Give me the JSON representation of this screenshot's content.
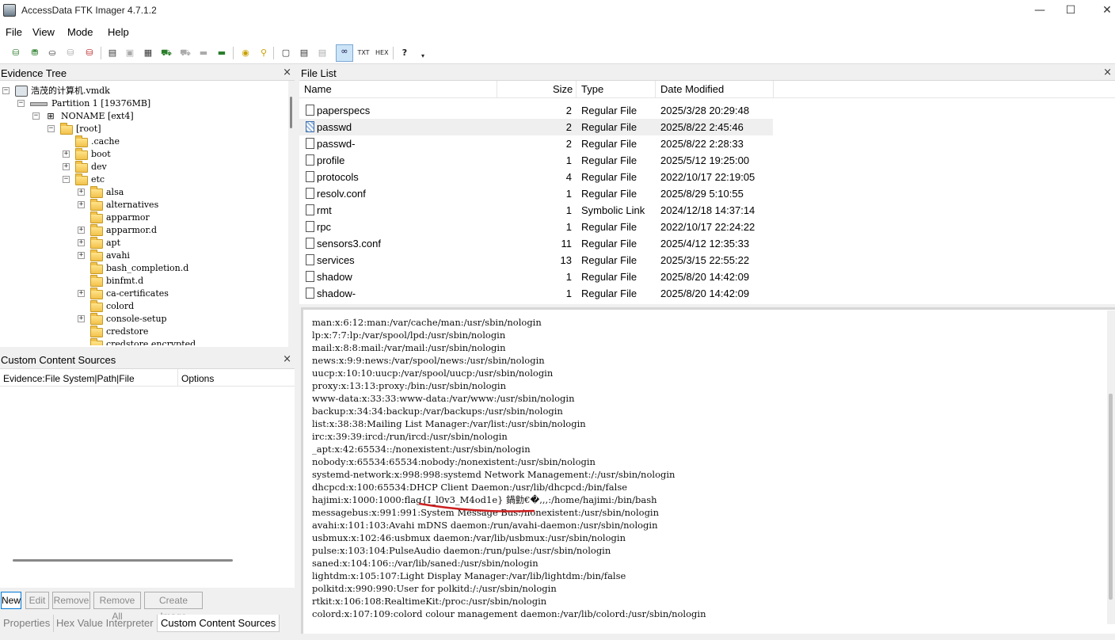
{
  "app": {
    "title": "AccessData FTK Imager 4.7.1.2"
  },
  "window_controls": {
    "minimize": "—",
    "maximize": "☐",
    "close": "✕"
  },
  "menu": [
    "File",
    "View",
    "Mode",
    "Help"
  ],
  "evidence_tree": {
    "title": "Evidence Tree",
    "close": "×",
    "items": [
      {
        "label": "浩茂的计算机.vmdk",
        "kind": "disk",
        "expander": "−"
      },
      {
        "label": "Partition 1 [19376MB]",
        "kind": "partition",
        "expander": "−"
      },
      {
        "label": "NONAME [ext4]",
        "kind": "fs",
        "expander": "−"
      },
      {
        "label": "[root]",
        "kind": "folder",
        "expander": "−"
      },
      {
        "label": ".cache",
        "kind": "folder",
        "expander": ""
      },
      {
        "label": "boot",
        "kind": "folder",
        "expander": "+"
      },
      {
        "label": "dev",
        "kind": "folder",
        "expander": "+"
      },
      {
        "label": "etc",
        "kind": "folder",
        "expander": "−"
      },
      {
        "label": "alsa",
        "kind": "folder",
        "expander": "+"
      },
      {
        "label": "alternatives",
        "kind": "folder",
        "expander": "+"
      },
      {
        "label": "apparmor",
        "kind": "folder",
        "expander": ""
      },
      {
        "label": "apparmor.d",
        "kind": "folder",
        "expander": "+"
      },
      {
        "label": "apt",
        "kind": "folder",
        "expander": "+"
      },
      {
        "label": "avahi",
        "kind": "folder",
        "expander": "+"
      },
      {
        "label": "bash_completion.d",
        "kind": "folder",
        "expander": ""
      },
      {
        "label": "binfmt.d",
        "kind": "folder",
        "expander": ""
      },
      {
        "label": "ca-certificates",
        "kind": "folder",
        "expander": "+"
      },
      {
        "label": "colord",
        "kind": "folder",
        "expander": ""
      },
      {
        "label": "console-setup",
        "kind": "folder",
        "expander": "+"
      },
      {
        "label": "credstore",
        "kind": "folder",
        "expander": ""
      },
      {
        "label": "credstore.encrypted",
        "kind": "folder",
        "expander": ""
      }
    ]
  },
  "custom_content_sources": {
    "title": "Custom Content Sources",
    "close": "×",
    "columns": [
      "Evidence:File System|Path|File",
      "Options"
    ],
    "buttons": [
      "New",
      "Edit",
      "Remove",
      "Remove All",
      "Create Image"
    ]
  },
  "bottom_tabs": [
    "Properties",
    "Hex Value Interpreter",
    "Custom Content Sources"
  ],
  "file_list": {
    "title": "File List",
    "close": "×",
    "columns": [
      "Name",
      "Size",
      "Type",
      "Date Modified"
    ],
    "rows": [
      {
        "name": "paperspecs",
        "size": "2",
        "type": "Regular File",
        "date": "2025/3/28 20:29:48"
      },
      {
        "name": "passwd",
        "size": "2",
        "type": "Regular File",
        "date": "2025/8/22 2:45:46",
        "selected": true
      },
      {
        "name": "passwd-",
        "size": "2",
        "type": "Regular File",
        "date": "2025/8/22 2:28:33"
      },
      {
        "name": "profile",
        "size": "1",
        "type": "Regular File",
        "date": "2025/5/12 19:25:00"
      },
      {
        "name": "protocols",
        "size": "4",
        "type": "Regular File",
        "date": "2022/10/17 22:19:05"
      },
      {
        "name": "resolv.conf",
        "size": "1",
        "type": "Regular File",
        "date": "2025/8/29 5:10:55"
      },
      {
        "name": "rmt",
        "size": "1",
        "type": "Symbolic Link",
        "date": "2024/12/18 14:37:14"
      },
      {
        "name": "rpc",
        "size": "1",
        "type": "Regular File",
        "date": "2022/10/17 22:24:22"
      },
      {
        "name": "sensors3.conf",
        "size": "11",
        "type": "Regular File",
        "date": "2025/4/12 12:35:33"
      },
      {
        "name": "services",
        "size": "13",
        "type": "Regular File",
        "date": "2025/3/15 22:55:22"
      },
      {
        "name": "shadow",
        "size": "1",
        "type": "Regular File",
        "date": "2025/8/20 14:42:09"
      },
      {
        "name": "shadow-",
        "size": "1",
        "type": "Regular File",
        "date": "2025/8/20 14:42:09"
      }
    ]
  },
  "text_view": {
    "lines": [
      "man:x:6:12:man:/var/cache/man:/usr/sbin/nologin",
      "lp:x:7:7:lp:/var/spool/lpd:/usr/sbin/nologin",
      "mail:x:8:8:mail:/var/mail:/usr/sbin/nologin",
      "news:x:9:9:news:/var/spool/news:/usr/sbin/nologin",
      "uucp:x:10:10:uucp:/var/spool/uucp:/usr/sbin/nologin",
      "proxy:x:13:13:proxy:/bin:/usr/sbin/nologin",
      "www-data:x:33:33:www-data:/var/www:/usr/sbin/nologin",
      "backup:x:34:34:backup:/var/backups:/usr/sbin/nologin",
      "list:x:38:38:Mailing List Manager:/var/list:/usr/sbin/nologin",
      "irc:x:39:39:ircd:/run/ircd:/usr/sbin/nologin",
      "_apt:x:42:65534::/nonexistent:/usr/sbin/nologin",
      "nobody:x:65534:65534:nobody:/nonexistent:/usr/sbin/nologin",
      "systemd-network:x:998:998:systemd Network Management:/:/usr/sbin/nologin",
      "dhcpcd:x:100:65534:DHCP Client Daemon:/usr/lib/dhcpcd:/bin/false",
      "hajimi:x:1000:1000:flag{I_l0v3_M4od1e} 鍋勭€�,,,:/home/hajimi:/bin/bash",
      "messagebus:x:991:991:System Message Bus:/nonexistent:/usr/sbin/nologin",
      "avahi:x:101:103:Avahi mDNS daemon:/run/avahi-daemon:/usr/sbin/nologin",
      "usbmux:x:102:46:usbmux daemon:/var/lib/usbmux:/usr/sbin/nologin",
      "pulse:x:103:104:PulseAudio daemon:/run/pulse:/usr/sbin/nologin",
      "saned:x:104:106::/var/lib/saned:/usr/sbin/nologin",
      "lightdm:x:105:107:Light Display Manager:/var/lib/lightdm:/bin/false",
      "polkitd:x:990:990:User for polkitd:/:/usr/sbin/nologin",
      "rtkit:x:106:108:RealtimeKit:/proc:/usr/sbin/nologin",
      "colord:x:107:109:colord colour management daemon:/var/lib/colord:/usr/sbin/nologin"
    ]
  },
  "colors": {
    "annotation": "#cc1f1f",
    "selection": "#cce4f7"
  }
}
